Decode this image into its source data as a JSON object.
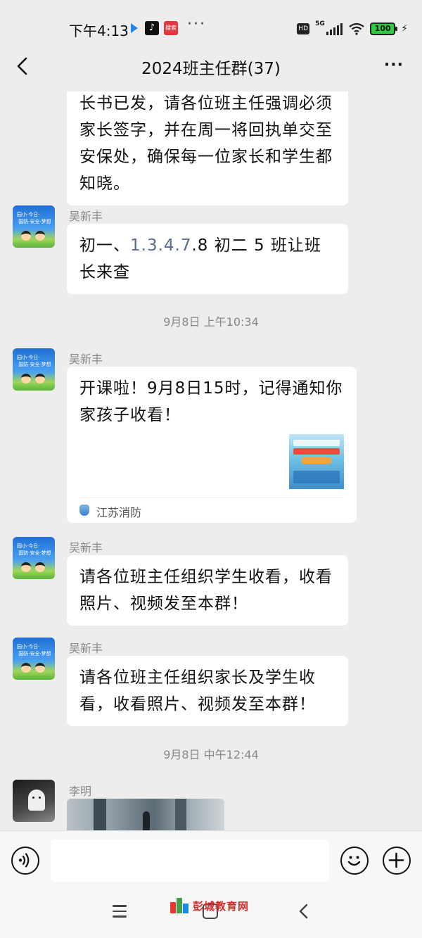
{
  "status_bar": {
    "time": "下午4:13",
    "search_app_label": "搜索",
    "more": "···",
    "hd": "HD",
    "network": "5G",
    "battery": "100"
  },
  "header": {
    "title": "2024班主任群(37)",
    "more": "···"
  },
  "messages": {
    "m0": {
      "text": "长书已发，请各位班主任强调必须家长签字，并在周一将回执单交至安保处，确保每一位家长和学生都知晓。"
    },
    "m1": {
      "sender": "吴新丰",
      "text_a": "初一、",
      "text_link": "1.3.4.7",
      "text_b": ".8 初二 5 班让班长来查"
    },
    "t1": "9月8日 上午10:34",
    "m2": {
      "sender": "吴新丰",
      "text": "开课啦！9月8日15时，记得通知你家孩子收看！",
      "source": "江苏消防"
    },
    "m3": {
      "sender": "吴新丰",
      "text": "请各位班主任组织学生收看，收看照片、视频发至本群！"
    },
    "m4": {
      "sender": "吴新丰",
      "text": "请各位班主任组织家长及学生收看，收看照片、视频发至本群！"
    },
    "t2": "9月8日 中午12:44",
    "m5": {
      "sender": "李明"
    }
  },
  "input": {
    "value": ""
  },
  "watermark": {
    "text": "彭城教育网"
  },
  "colors": {
    "background": "#ededed",
    "bubble": "#ffffff",
    "link": "#5b6b8f",
    "meta": "#888888"
  }
}
